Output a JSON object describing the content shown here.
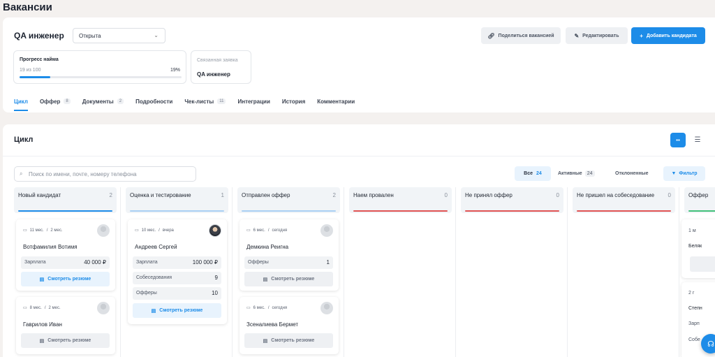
{
  "page": {
    "title": "Вакансии"
  },
  "vacancy": {
    "title": "QA инженер",
    "status": "Открыта",
    "share_label": "Поделиться вакансией",
    "edit_label": "Редактировать",
    "add_label": "Добавить кандидата"
  },
  "progress": {
    "title": "Прогресс найма",
    "count": "19 из 100",
    "percent_text": "19%",
    "value": 0.19
  },
  "linked": {
    "label": "Связанная заявка",
    "value": "QA инженер"
  },
  "tabs": [
    {
      "label": "Цикл",
      "count": ""
    },
    {
      "label": "Оффер",
      "count": "8"
    },
    {
      "label": "Документы",
      "count": "2"
    },
    {
      "label": "Подробности",
      "count": ""
    },
    {
      "label": "Чек-листы",
      "count": "11"
    },
    {
      "label": "Интеграции",
      "count": ""
    },
    {
      "label": "История",
      "count": ""
    },
    {
      "label": "Комментарии",
      "count": ""
    }
  ],
  "cycle": {
    "title": "Цикл",
    "search_placeholder": "Поиск по имени, почте, номеру телефона",
    "filters": {
      "all_label": "Все",
      "all_count": "24",
      "active_label": "Активные",
      "active_count": "24",
      "rejected_label": "Отклоненные",
      "filter_label": "Фильтр"
    }
  },
  "colors": {
    "accent": "#1d8ce8",
    "red": "#e05353",
    "green": "#41c07a"
  },
  "columns": [
    {
      "name": "Новый кандидат",
      "count": "2",
      "line": "#1d8ce8"
    },
    {
      "name": "Оценка и тестирование",
      "count": "1",
      "line": "#a9cff3"
    },
    {
      "name": "Отправлен оффер",
      "count": "2",
      "line": "#a9cff3"
    },
    {
      "name": "Наем провален",
      "count": "0",
      "line": "#e05353"
    },
    {
      "name": "Не принял оффер",
      "count": "0",
      "line": "#e05353"
    },
    {
      "name": "Не пришел на собеседование",
      "count": "0",
      "line": "#e05353"
    },
    {
      "name": "Оффер",
      "count": "",
      "line": "#41c07a"
    }
  ],
  "cards": {
    "c1": {
      "from": "11 мес.",
      "to": "2 мес.",
      "name": "Вотфамилия Вотимя",
      "salary_label": "Зарплата",
      "salary": "40 000 ₽",
      "resume": "Смотреть резюме"
    },
    "c2": {
      "from": "8 мес.",
      "to": "2 мес.",
      "name": "Гаврилов Иван",
      "resume": "Смотреть резюме"
    },
    "c3": {
      "from": "10 мес.",
      "to": "вчера",
      "name": "Андреев Сергей",
      "salary_label": "Зарплата",
      "salary": "100 000 ₽",
      "interviews_label": "Собеседования",
      "interviews": "9",
      "offers_label": "Офферы",
      "offers": "10",
      "resume": "Смотреть резюме"
    },
    "c4": {
      "from": "6 мес.",
      "to": "сегодня",
      "name": "Демкина Реигна",
      "offers_label": "Офферы",
      "offers": "1",
      "resume": "Смотреть резюме"
    },
    "c5": {
      "from": "6 мес.",
      "to": "сегодня",
      "name": "Зсеналиева Бермет",
      "resume": "Смотреть резюме"
    },
    "p1": {
      "date": "1 м",
      "name": "Беляк"
    },
    "p2": {
      "date": "2 г",
      "name": "Степн",
      "r1": "Зарп",
      "r2": "Собе"
    }
  }
}
